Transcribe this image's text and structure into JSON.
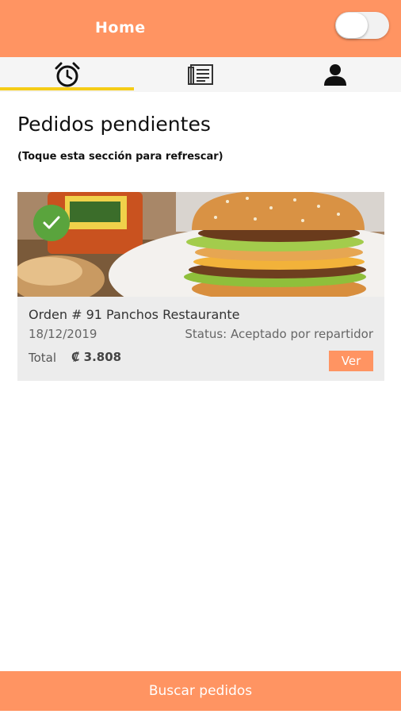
{
  "app_bar": {
    "title": "Home",
    "toggle_state": "off",
    "background_color": "#ff9462"
  },
  "tabs": [
    {
      "icon": "alarm-clock-icon",
      "selected": true
    },
    {
      "icon": "document-list-icon",
      "selected": false
    },
    {
      "icon": "person-icon",
      "selected": false
    }
  ],
  "tab_indicator_color": "#f5cc17",
  "section": {
    "title": "Pedidos pendientes",
    "hint": "(Toque esta sección para refrescar)"
  },
  "orders": [
    {
      "title": "Orden # 91 Panchos Restaurante",
      "date": "18/12/2019",
      "status": "Status: Aceptado por repartidor",
      "total_label": "Total",
      "total_value": "₡ 3.808",
      "button_label": "Ver",
      "badge_icon": "checkmark-icon",
      "image_icon": "burger-photo"
    }
  ],
  "bottom_button": {
    "label": "Buscar pedidos"
  }
}
